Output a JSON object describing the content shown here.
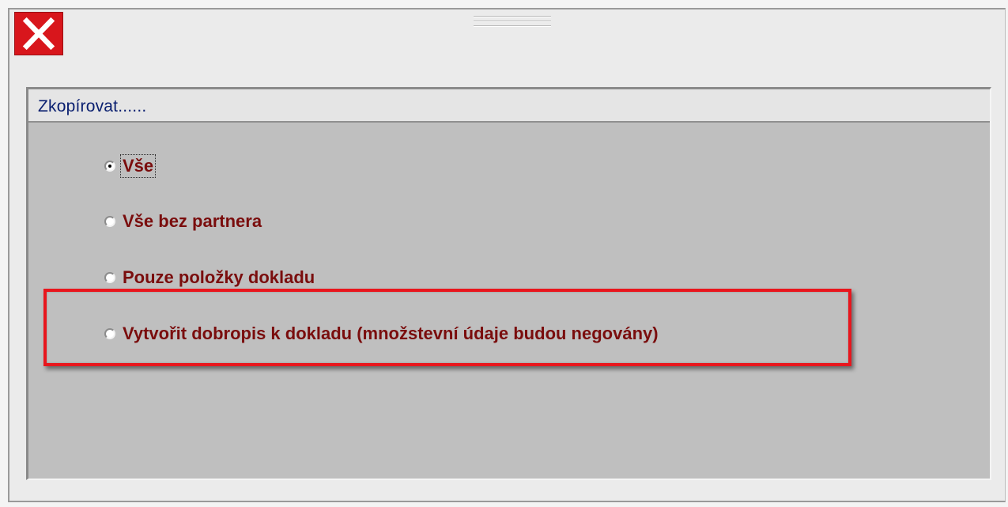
{
  "window": {
    "close_icon": "close-x-icon",
    "accent_color": "#d8161c"
  },
  "group": {
    "title": "Zkopírovat......"
  },
  "options": [
    {
      "label": "Vše",
      "selected": true
    },
    {
      "label": "Vše bez partnera",
      "selected": false
    },
    {
      "label": "Pouze položky dokladu",
      "selected": false
    },
    {
      "label": "Vytvořit dobropis k dokladu (množstevní údaje budou negovány)",
      "selected": false
    }
  ],
  "highlight_color": "#e8161d"
}
